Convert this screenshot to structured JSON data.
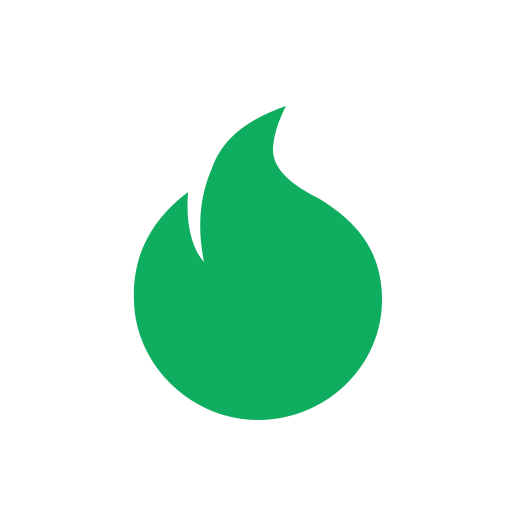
{
  "icon": {
    "name": "flame-icon",
    "color": "#0FAD5F",
    "background": "#FFFFFF"
  }
}
